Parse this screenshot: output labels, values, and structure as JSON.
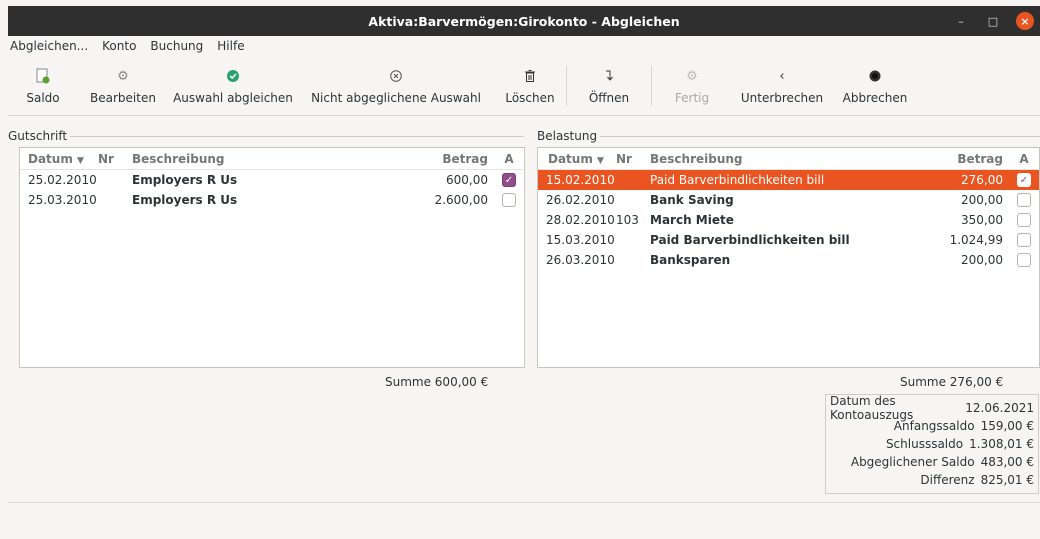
{
  "window": {
    "title": "Aktiva:Barvermögen:Girokonto - Abgleichen"
  },
  "menu": [
    "Abgleichen...",
    "Konto",
    "Buchung",
    "Hilfe"
  ],
  "toolbar": {
    "saldo": "Saldo",
    "bearbeiten": "Bearbeiten",
    "auswahl_abgleichen": "Auswahl abgleichen",
    "nicht_abgeglichene": "Nicht abgeglichene Auswahl",
    "loeschen": "Löschen",
    "oeffnen": "Öffnen",
    "fertig": "Fertig",
    "unterbrechen": "Unterbrechen",
    "abbrechen": "Abbrechen"
  },
  "columns": {
    "datum": "Datum",
    "nr": "Nr",
    "beschreibung": "Beschreibung",
    "betrag": "Betrag",
    "a": "A"
  },
  "gutschrift": {
    "label": "Gutschrift",
    "rows": [
      {
        "datum": "25.02.2010",
        "nr": "",
        "beschreibung": "Employers R Us",
        "betrag": "600,00",
        "checked": true
      },
      {
        "datum": "25.03.2010",
        "nr": "",
        "beschreibung": "Employers R Us",
        "betrag": "2.600,00",
        "checked": false
      }
    ],
    "summe": "Summe 600,00 €"
  },
  "belastung": {
    "label": "Belastung",
    "rows": [
      {
        "datum": "15.02.2010",
        "nr": "",
        "beschreibung": "Paid Barverbindlichkeiten bill",
        "betrag": "276,00",
        "checked": true,
        "selected": true
      },
      {
        "datum": "26.02.2010",
        "nr": "",
        "beschreibung": "Bank Saving",
        "betrag": "200,00",
        "checked": false
      },
      {
        "datum": "28.02.2010",
        "nr": "103",
        "beschreibung": "March Miete",
        "betrag": "350,00",
        "checked": false
      },
      {
        "datum": "15.03.2010",
        "nr": "",
        "beschreibung": "Paid Barverbindlichkeiten bill",
        "betrag": "1.024,99",
        "checked": false
      },
      {
        "datum": "26.03.2010",
        "nr": "",
        "beschreibung": "Bankspar­en",
        "betrag": "200,00",
        "checked": false
      }
    ],
    "summe": "Summe 276,00 €"
  },
  "summary": {
    "datum_label": "Datum des Kontoauszugs",
    "datum_value": "12.06.2021",
    "anfang_label": "Anfangssaldo",
    "anfang_value": "159,00 €",
    "schluss_label": "Schlusssaldo",
    "schluss_value": "1.308,01 €",
    "abgeglichen_label": "Abgeglichener Saldo",
    "abgeglichen_value": "483,00 €",
    "differenz_label": "Differenz",
    "differenz_value": "825,01 €"
  },
  "colors": {
    "accent": "#e95420",
    "check": "#924d8b"
  }
}
